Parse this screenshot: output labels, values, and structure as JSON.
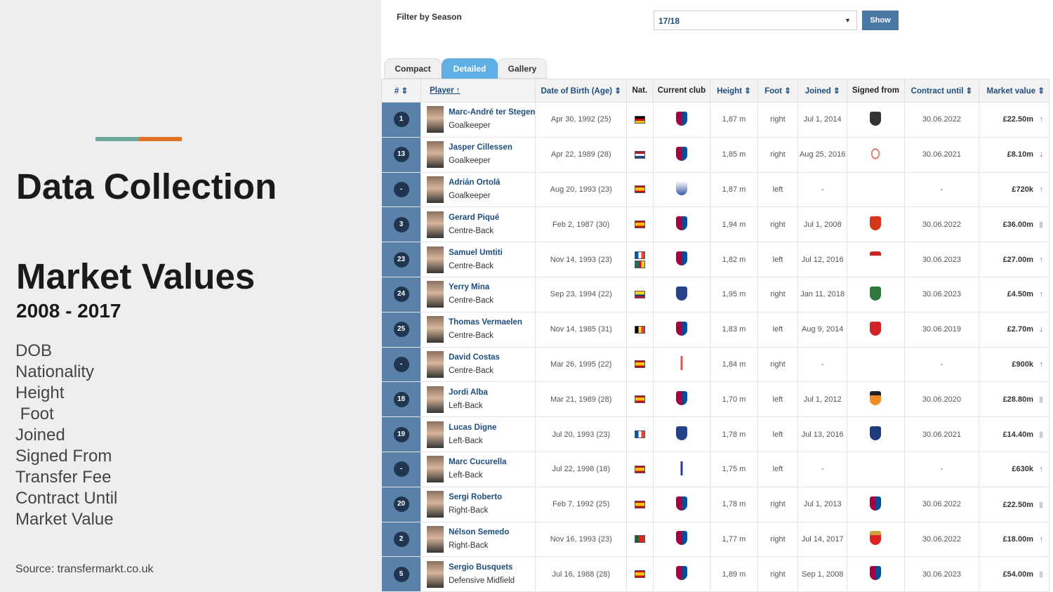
{
  "slide": {
    "title": "Data Collection",
    "subtitle": "Market Values",
    "years": "2008 - 2017",
    "fields": [
      "DOB",
      "Nationality",
      "Height",
      " Foot",
      "Joined",
      "Signed From",
      "Transfer Fee",
      "Contract Until",
      "Market Value"
    ],
    "source": "Source: transfermarkt.co.uk",
    "accent_colors": [
      "#6fa79a",
      "#de7326"
    ]
  },
  "filter": {
    "label": "Filter by Season",
    "season": "17/18",
    "show_label": "Show"
  },
  "tabs": [
    "Compact",
    "Detailed",
    "Gallery"
  ],
  "active_tab": "Detailed",
  "columns": [
    "# ⇕",
    "Player ↑",
    "Date of Birth (Age) ⇕",
    "Nat.",
    "Current club",
    "Height ⇕",
    "Foot ⇕",
    "Joined ⇕",
    "Signed from",
    "Contract until ⇕",
    "Market value ⇕"
  ],
  "players": [
    {
      "num": "1",
      "name": "Marc-André ter Stegen",
      "pos": "Goalkeeper",
      "dob": "Apr 30, 1992 (25)",
      "nat": [
        "germany"
      ],
      "club": "barcelona",
      "height": "1,87 m",
      "foot": "right",
      "joined": "Jul 1, 2014",
      "from": "gladbach",
      "contract": "30.06.2022",
      "value": "£22.50m",
      "trend": "up"
    },
    {
      "num": "13",
      "name": "Jasper Cillessen",
      "pos": "Goalkeeper",
      "dob": "Apr 22, 1989 (28)",
      "nat": [
        "netherlands"
      ],
      "club": "barcelona",
      "height": "1,85 m",
      "foot": "right",
      "joined": "Aug 25, 2016",
      "from": "ajax",
      "contract": "30.06.2021",
      "value": "£8.10m",
      "trend": "down"
    },
    {
      "num": "-",
      "name": "Adrián Ortolá",
      "pos": "Goalkeeper",
      "dob": "Aug 20, 1993 (23)",
      "nat": [
        "spain"
      ],
      "club": "deportivo",
      "height": "1,87 m",
      "foot": "left",
      "joined": "-",
      "from": "",
      "contract": "-",
      "value": "£720k",
      "trend": "up"
    },
    {
      "num": "3",
      "name": "Gerard Piqué",
      "pos": "Centre-Back",
      "dob": "Feb 2, 1987 (30)",
      "nat": [
        "spain"
      ],
      "club": "barcelona",
      "height": "1,94 m",
      "foot": "right",
      "joined": "Jul 1, 2008",
      "from": "man-utd",
      "contract": "30.06.2022",
      "value": "£36.00m",
      "trend": "none"
    },
    {
      "num": "23",
      "name": "Samuel Umtiti",
      "pos": "Centre-Back",
      "dob": "Nov 14, 1993 (23)",
      "nat": [
        "france",
        "cameroon"
      ],
      "club": "barcelona",
      "height": "1,82 m",
      "foot": "left",
      "joined": "Jul 12, 2016",
      "from": "lyon",
      "contract": "30.06.2023",
      "value": "£27.00m",
      "trend": "up"
    },
    {
      "num": "24",
      "name": "Yerry Mina",
      "pos": "Centre-Back",
      "dob": "Sep 23, 1994 (22)",
      "nat": [
        "colombia"
      ],
      "club": "everton",
      "height": "1,95 m",
      "foot": "right",
      "joined": "Jan 11, 2018",
      "from": "palmeiras",
      "contract": "30.06.2023",
      "value": "£4.50m",
      "trend": "up"
    },
    {
      "num": "25",
      "name": "Thomas Vermaelen",
      "pos": "Centre-Back",
      "dob": "Nov 14, 1985 (31)",
      "nat": [
        "belgium"
      ],
      "club": "barcelona",
      "height": "1,83 m",
      "foot": "left",
      "joined": "Aug 9, 2014",
      "from": "arsenal",
      "contract": "30.06.2019",
      "value": "£2.70m",
      "trend": "down"
    },
    {
      "num": "-",
      "name": "David Costas",
      "pos": "Centre-Back",
      "dob": "Mar 26, 1995 (22)",
      "nat": [
        "spain"
      ],
      "club": "celta",
      "height": "1,84 m",
      "foot": "right",
      "joined": "-",
      "from": "",
      "contract": "-",
      "value": "£900k",
      "trend": "up"
    },
    {
      "num": "18",
      "name": "Jordi Alba",
      "pos": "Left-Back",
      "dob": "Mar 21, 1989 (28)",
      "nat": [
        "spain"
      ],
      "club": "barcelona",
      "height": "1,70 m",
      "foot": "left",
      "joined": "Jul 1, 2012",
      "from": "valencia",
      "contract": "30.06.2020",
      "value": "£28.80m",
      "trend": "none"
    },
    {
      "num": "19",
      "name": "Lucas Digne",
      "pos": "Left-Back",
      "dob": "Jul 20, 1993 (23)",
      "nat": [
        "france"
      ],
      "club": "everton",
      "height": "1,78 m",
      "foot": "left",
      "joined": "Jul 13, 2016",
      "from": "psg",
      "contract": "30.06.2021",
      "value": "£14.40m",
      "trend": "none"
    },
    {
      "num": "-",
      "name": "Marc Cucurella",
      "pos": "Left-Back",
      "dob": "Jul 22, 1998 (18)",
      "nat": [
        "spain"
      ],
      "club": "eibar",
      "height": "1,75 m",
      "foot": "left",
      "joined": "-",
      "from": "",
      "contract": "-",
      "value": "£630k",
      "trend": "up"
    },
    {
      "num": "20",
      "name": "Sergi Roberto",
      "pos": "Right-Back",
      "dob": "Feb 7, 1992 (25)",
      "nat": [
        "spain"
      ],
      "club": "barcelona",
      "height": "1,78 m",
      "foot": "right",
      "joined": "Jul 1, 2013",
      "from": "barcelona",
      "contract": "30.06.2022",
      "value": "£22.50m",
      "trend": "none"
    },
    {
      "num": "2",
      "name": "Nélson Semedo",
      "pos": "Right-Back",
      "dob": "Nov 16, 1993 (23)",
      "nat": [
        "portugal"
      ],
      "club": "barcelona",
      "height": "1,77 m",
      "foot": "right",
      "joined": "Jul 14, 2017",
      "from": "benfica",
      "contract": "30.06.2022",
      "value": "£18.00m",
      "trend": "up"
    },
    {
      "num": "5",
      "name": "Sergio Busquets",
      "pos": "Defensive Midfield",
      "dob": "Jul 16, 1988 (28)",
      "nat": [
        "spain"
      ],
      "club": "barcelona",
      "height": "1,89 m",
      "foot": "right",
      "joined": "Sep 1, 2008",
      "from": "barcelona",
      "contract": "30.06.2023",
      "value": "£54.00m",
      "trend": "none"
    }
  ]
}
